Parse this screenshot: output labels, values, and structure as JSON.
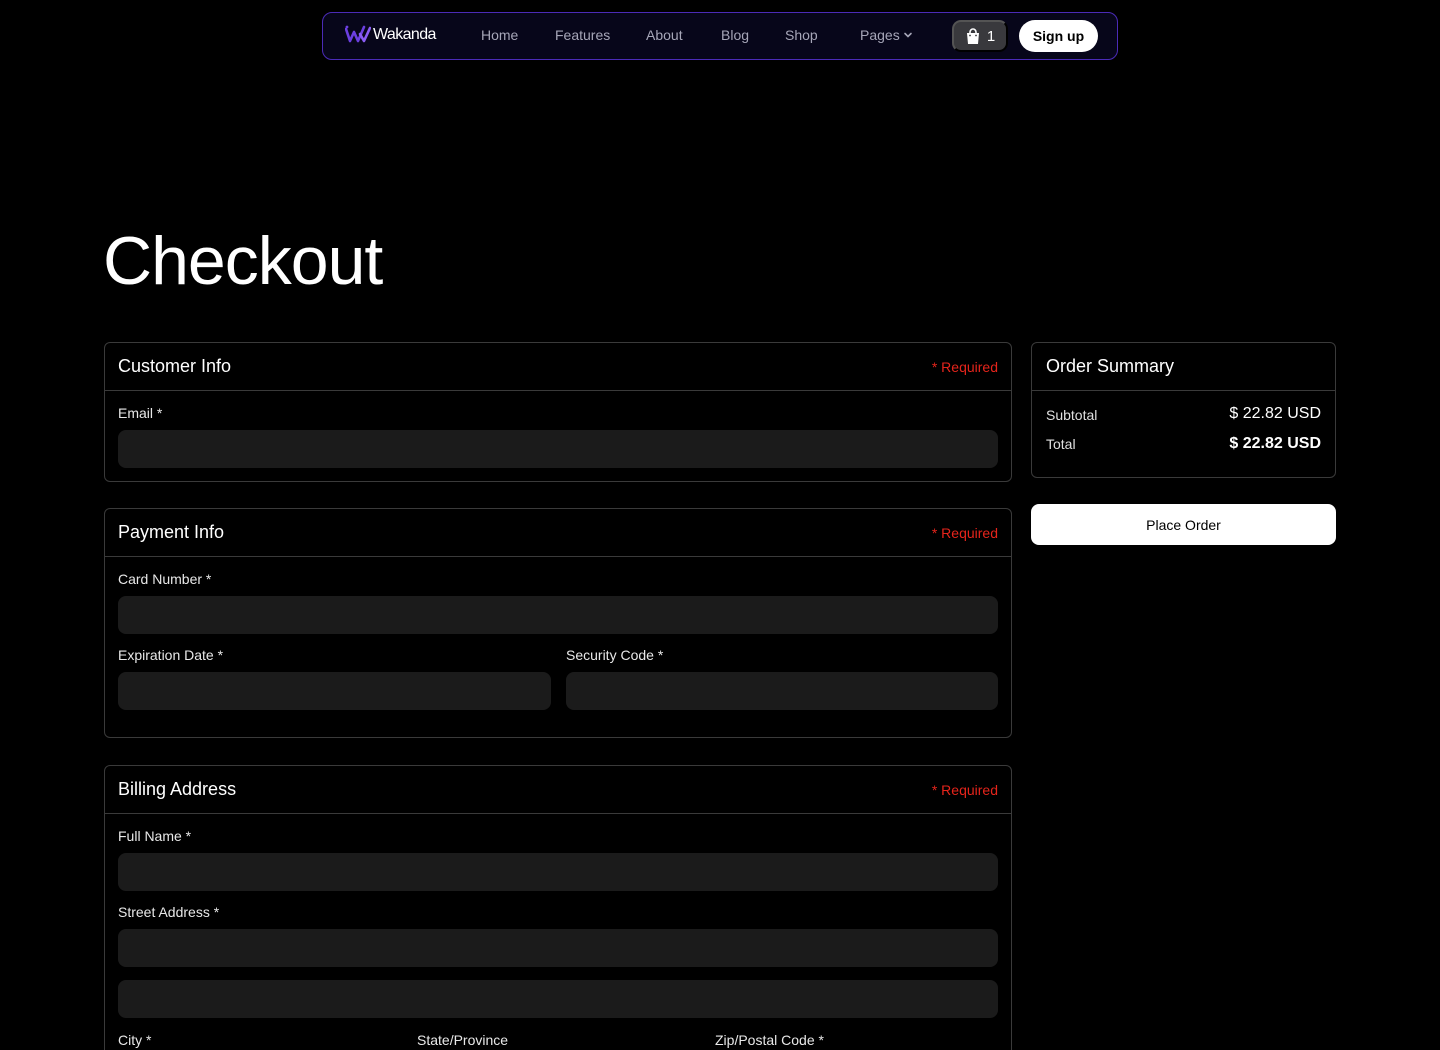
{
  "nav": {
    "brand": "Wakanda",
    "links": [
      "Home",
      "Features",
      "About",
      "Blog",
      "Shop"
    ],
    "pages_label": "Pages",
    "cart_count": "1",
    "signup_label": "Sign up",
    "accent_color": "#6b3fe0"
  },
  "page": {
    "title": "Checkout"
  },
  "customer_info": {
    "title": "Customer Info",
    "required": "* Required",
    "email_label": "Email *",
    "email_value": ""
  },
  "payment_info": {
    "title": "Payment Info",
    "required": "* Required",
    "card_number_label": "Card Number *",
    "expiration_label": "Expiration Date *",
    "security_label": "Security Code *"
  },
  "billing_address": {
    "title": "Billing Address",
    "required": "* Required",
    "full_name_label": "Full Name *",
    "street_label": "Street Address *",
    "city_label": "City *",
    "state_label": "State/Province",
    "zip_label": "Zip/Postal Code *"
  },
  "order_summary": {
    "title": "Order Summary",
    "subtotal_label": "Subtotal",
    "subtotal_value": "$ 22.82 USD",
    "total_label": "Total",
    "total_value": "$ 22.82 USD",
    "place_order_label": "Place Order"
  },
  "colors": {
    "required": "#e5241b",
    "input_bg": "#1b1b1b",
    "border": "#3a3a3a"
  }
}
